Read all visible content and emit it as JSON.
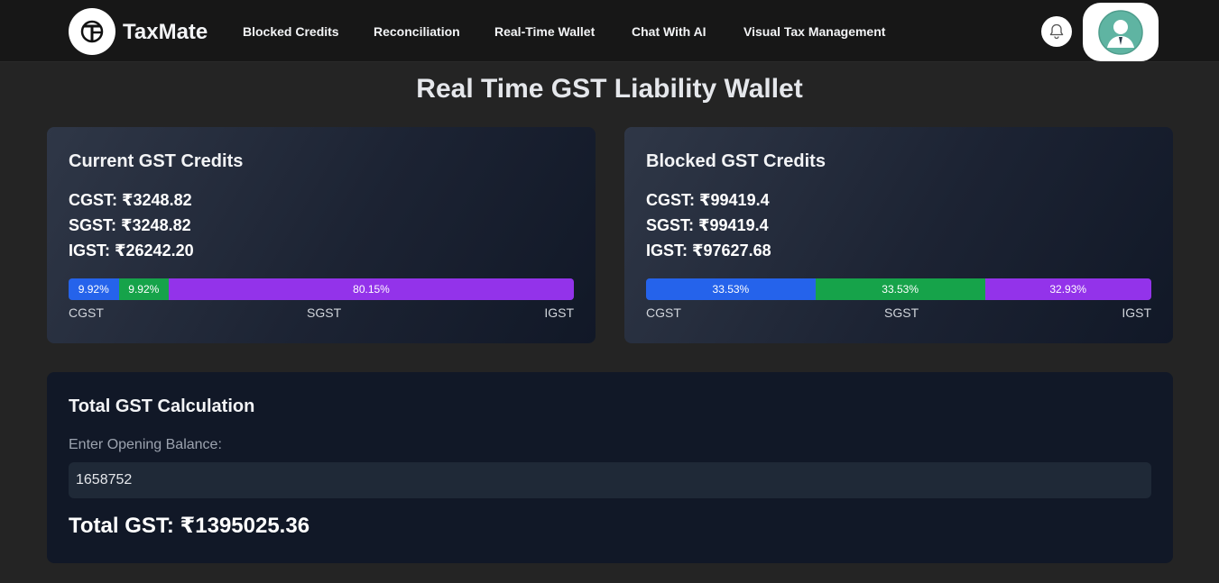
{
  "nav": {
    "brand": "TaxMate",
    "links": [
      "Blocked Credits",
      "Reconciliation",
      "Real-Time Wallet",
      "Chat With AI",
      "Visual Tax Management"
    ],
    "icons": {
      "logo": "taxmate-logo-icon",
      "bell": "bell-icon",
      "avatar": "user-avatar-icon"
    }
  },
  "page_title": "Real Time GST Liability Wallet",
  "current_credits": {
    "title": "Current GST Credits",
    "lines": [
      "CGST: ₹3248.82",
      "SGST: ₹3248.82",
      "IGST: ₹26242.20"
    ],
    "segments": [
      {
        "label": "9.92%",
        "fraction": 0.0992,
        "color": "#2563eb"
      },
      {
        "label": "9.92%",
        "fraction": 0.0992,
        "color": "#16a34a"
      },
      {
        "label": "80.15%",
        "fraction": 0.8015,
        "color": "#9333ea"
      }
    ],
    "legend": [
      "CGST",
      "SGST",
      "IGST"
    ]
  },
  "blocked_credits": {
    "title": "Blocked GST Credits",
    "lines": [
      "CGST: ₹99419.4",
      "SGST: ₹99419.4",
      "IGST: ₹97627.68"
    ],
    "segments": [
      {
        "label": "33.53%",
        "fraction": 0.3353,
        "color": "#2563eb"
      },
      {
        "label": "33.53%",
        "fraction": 0.3353,
        "color": "#16a34a"
      },
      {
        "label": "32.93%",
        "fraction": 0.3293,
        "color": "#9333ea"
      }
    ],
    "legend": [
      "CGST",
      "SGST",
      "IGST"
    ]
  },
  "total": {
    "title": "Total GST Calculation",
    "input_label": "Enter Opening Balance:",
    "input_value": "1658752",
    "result": "Total GST: ₹1395025.36"
  }
}
